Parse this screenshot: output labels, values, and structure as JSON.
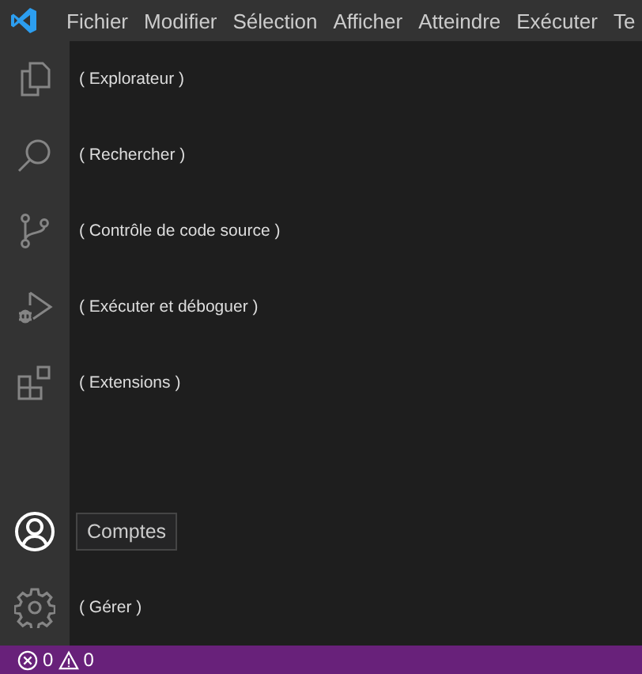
{
  "menu_bar": {
    "items": [
      "Fichier",
      "Modifier",
      "Sélection",
      "Afficher",
      "Atteindre",
      "Exécuter",
      "Te"
    ]
  },
  "activity_bar": {
    "top": [
      {
        "kind": "files",
        "label": "( Explorateur )",
        "highlighted": false
      },
      {
        "kind": "search",
        "label": "( Rechercher )",
        "highlighted": false
      },
      {
        "kind": "branch",
        "label": "( Contrôle de code source )",
        "highlighted": false
      },
      {
        "kind": "debug",
        "label": "( Exécuter et déboguer )",
        "highlighted": false
      },
      {
        "kind": "extensions",
        "label": "( Extensions )",
        "highlighted": false
      }
    ],
    "bottom": [
      {
        "kind": "account",
        "label": "Comptes",
        "highlighted": true
      },
      {
        "kind": "gear",
        "label": "( Gérer )",
        "highlighted": false
      }
    ]
  },
  "status_bar": {
    "errors": "0",
    "warnings": "0"
  }
}
